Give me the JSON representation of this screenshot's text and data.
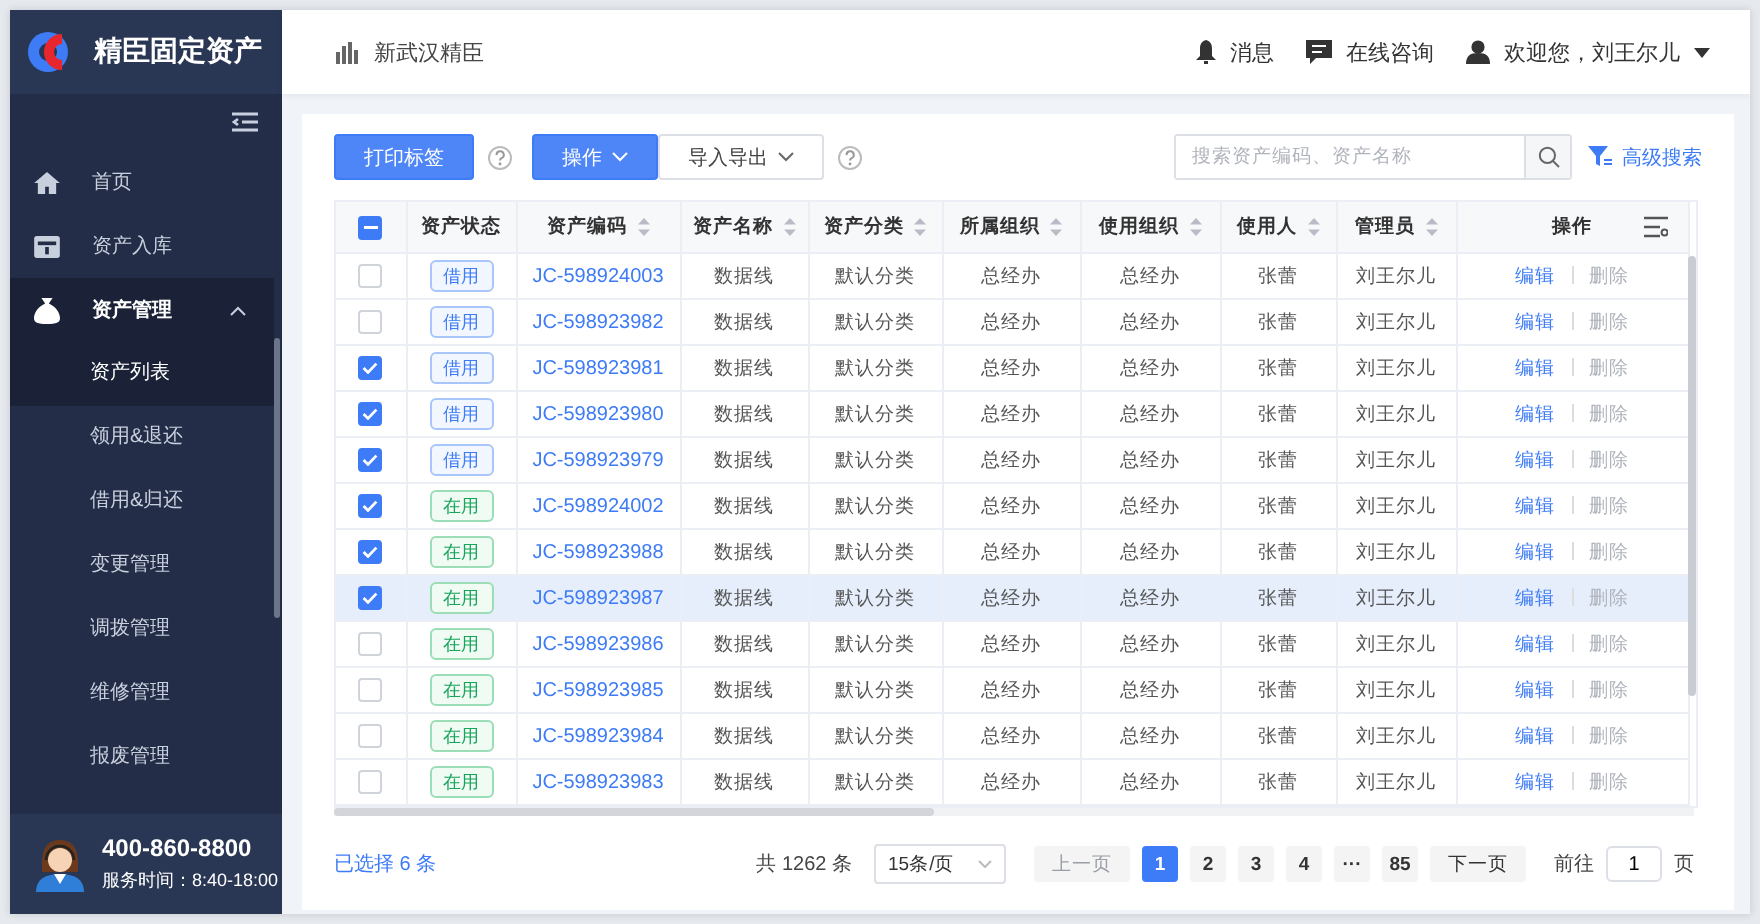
{
  "app": {
    "name": "精臣固定资产"
  },
  "sidebar": {
    "items": [
      {
        "label": "首页"
      },
      {
        "label": "资产入库"
      },
      {
        "label": "资产管理",
        "expanded": true,
        "children": [
          {
            "label": "资产列表",
            "selected": true
          },
          {
            "label": "领用&退还",
            "selected": false
          },
          {
            "label": "借用&归还",
            "selected": false
          },
          {
            "label": "变更管理",
            "selected": false
          },
          {
            "label": "调拨管理",
            "selected": false
          },
          {
            "label": "维修管理",
            "selected": false
          },
          {
            "label": "报废管理",
            "selected": false
          }
        ]
      }
    ],
    "support": {
      "phone": "400-860-8800",
      "hours": "服务时间：8:40-18:00"
    }
  },
  "header": {
    "breadcrumb": "新武汉精臣",
    "messages": "消息",
    "consult": "在线咨询",
    "user": "欢迎您，刘王尔儿"
  },
  "toolbar": {
    "buttons": [
      {
        "label": "打印标签",
        "kind": "primary",
        "dropdown": false,
        "help": true
      },
      {
        "label": "操作",
        "kind": "primary",
        "dropdown": true,
        "help": false
      },
      {
        "label": "导入导出",
        "kind": "default",
        "dropdown": true,
        "help": true
      }
    ],
    "search": {
      "placeholder": "搜索资产编码、资产名称"
    },
    "advanced": "高级搜索"
  },
  "table": {
    "select_all_partial": true,
    "columns": [
      {
        "label": "资产状态",
        "sortable": false
      },
      {
        "label": "资产编码",
        "sortable": true
      },
      {
        "label": "资产名称",
        "sortable": true
      },
      {
        "label": "资产分类",
        "sortable": true
      },
      {
        "label": "所属组织",
        "sortable": true
      },
      {
        "label": "使用组织",
        "sortable": true
      },
      {
        "label": "使用人",
        "sortable": true
      },
      {
        "label": "管理员",
        "sortable": true
      },
      {
        "label": "操作",
        "sortable": false
      }
    ],
    "rows": [
      {
        "checked": false,
        "highlighted": false,
        "cells": [
          {
            "label": "借用",
            "kind": "borrowed"
          },
          "JC-598924003",
          "数据线",
          "默认分类",
          "总经办",
          "总经办",
          "张蕾",
          "刘王尔儿"
        ],
        "actions": [
          {
            "label": "编辑",
            "disabled": false
          },
          {
            "label": "删除",
            "disabled": true
          }
        ]
      },
      {
        "checked": false,
        "highlighted": false,
        "cells": [
          {
            "label": "借用",
            "kind": "borrowed"
          },
          "JC-598923982",
          "数据线",
          "默认分类",
          "总经办",
          "总经办",
          "张蕾",
          "刘王尔儿"
        ],
        "actions": [
          {
            "label": "编辑",
            "disabled": false
          },
          {
            "label": "删除",
            "disabled": true
          }
        ]
      },
      {
        "checked": true,
        "highlighted": false,
        "cells": [
          {
            "label": "借用",
            "kind": "borrowed"
          },
          "JC-598923981",
          "数据线",
          "默认分类",
          "总经办",
          "总经办",
          "张蕾",
          "刘王尔儿"
        ],
        "actions": [
          {
            "label": "编辑",
            "disabled": false
          },
          {
            "label": "删除",
            "disabled": true
          }
        ]
      },
      {
        "checked": true,
        "highlighted": false,
        "cells": [
          {
            "label": "借用",
            "kind": "borrowed"
          },
          "JC-598923980",
          "数据线",
          "默认分类",
          "总经办",
          "总经办",
          "张蕾",
          "刘王尔儿"
        ],
        "actions": [
          {
            "label": "编辑",
            "disabled": false
          },
          {
            "label": "删除",
            "disabled": true
          }
        ]
      },
      {
        "checked": true,
        "highlighted": false,
        "cells": [
          {
            "label": "借用",
            "kind": "borrowed"
          },
          "JC-598923979",
          "数据线",
          "默认分类",
          "总经办",
          "总经办",
          "张蕾",
          "刘王尔儿"
        ],
        "actions": [
          {
            "label": "编辑",
            "disabled": false
          },
          {
            "label": "删除",
            "disabled": true
          }
        ]
      },
      {
        "checked": true,
        "highlighted": false,
        "cells": [
          {
            "label": "在用",
            "kind": "in_use"
          },
          "JC-598924002",
          "数据线",
          "默认分类",
          "总经办",
          "总经办",
          "张蕾",
          "刘王尔儿"
        ],
        "actions": [
          {
            "label": "编辑",
            "disabled": false
          },
          {
            "label": "删除",
            "disabled": true
          }
        ]
      },
      {
        "checked": true,
        "highlighted": false,
        "cells": [
          {
            "label": "在用",
            "kind": "in_use"
          },
          "JC-598923988",
          "数据线",
          "默认分类",
          "总经办",
          "总经办",
          "张蕾",
          "刘王尔儿"
        ],
        "actions": [
          {
            "label": "编辑",
            "disabled": false
          },
          {
            "label": "删除",
            "disabled": true
          }
        ]
      },
      {
        "checked": true,
        "highlighted": true,
        "cells": [
          {
            "label": "在用",
            "kind": "in_use"
          },
          "JC-598923987",
          "数据线",
          "默认分类",
          "总经办",
          "总经办",
          "张蕾",
          "刘王尔儿"
        ],
        "actions": [
          {
            "label": "编辑",
            "disabled": false
          },
          {
            "label": "删除",
            "disabled": true
          }
        ]
      },
      {
        "checked": false,
        "highlighted": false,
        "cells": [
          {
            "label": "在用",
            "kind": "in_use"
          },
          "JC-598923986",
          "数据线",
          "默认分类",
          "总经办",
          "总经办",
          "张蕾",
          "刘王尔儿"
        ],
        "actions": [
          {
            "label": "编辑",
            "disabled": false
          },
          {
            "label": "删除",
            "disabled": true
          }
        ]
      },
      {
        "checked": false,
        "highlighted": false,
        "cells": [
          {
            "label": "在用",
            "kind": "in_use"
          },
          "JC-598923985",
          "数据线",
          "默认分类",
          "总经办",
          "总经办",
          "张蕾",
          "刘王尔儿"
        ],
        "actions": [
          {
            "label": "编辑",
            "disabled": false
          },
          {
            "label": "删除",
            "disabled": true
          }
        ]
      },
      {
        "checked": false,
        "highlighted": false,
        "cells": [
          {
            "label": "在用",
            "kind": "in_use"
          },
          "JC-598923984",
          "数据线",
          "默认分类",
          "总经办",
          "总经办",
          "张蕾",
          "刘王尔儿"
        ],
        "actions": [
          {
            "label": "编辑",
            "disabled": false
          },
          {
            "label": "删除",
            "disabled": true
          }
        ]
      },
      {
        "checked": false,
        "highlighted": false,
        "cells": [
          {
            "label": "在用",
            "kind": "in_use"
          },
          "JC-598923983",
          "数据线",
          "默认分类",
          "总经办",
          "总经办",
          "张蕾",
          "刘王尔儿"
        ],
        "actions": [
          {
            "label": "编辑",
            "disabled": false
          },
          {
            "label": "删除",
            "disabled": true
          }
        ]
      }
    ]
  },
  "footer": {
    "selected_text": "已选择 6 条",
    "total": "共 1262 条",
    "page_size": "15条/页",
    "prev": {
      "label": "上一页",
      "disabled": true
    },
    "pages": [
      {
        "label": "1",
        "selected": true
      },
      {
        "label": "2",
        "selected": false
      },
      {
        "label": "3",
        "selected": false
      },
      {
        "label": "4",
        "selected": false
      },
      {
        "label": "···",
        "selected": false
      },
      {
        "label": "85",
        "selected": false
      }
    ],
    "next": {
      "label": "下一页",
      "disabled": false
    },
    "goto": {
      "prefix": "前往",
      "value": "1",
      "suffix": "页"
    }
  }
}
